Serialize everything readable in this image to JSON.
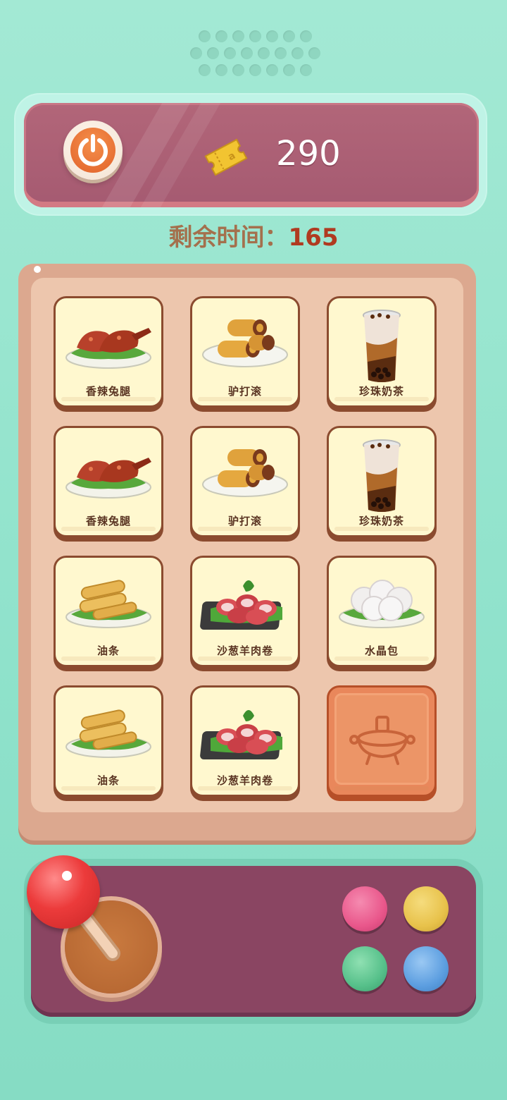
{
  "score": "290",
  "time": {
    "label": "剩余时间：",
    "value": "165"
  },
  "tiles": [
    {
      "label": "香辣兔腿",
      "food": "rabbit-leg"
    },
    {
      "label": "驴打滚",
      "food": "donkey-roll"
    },
    {
      "label": "珍珠奶茶",
      "food": "bubble-tea"
    },
    {
      "label": "香辣兔腿",
      "food": "rabbit-leg"
    },
    {
      "label": "驴打滚",
      "food": "donkey-roll"
    },
    {
      "label": "珍珠奶茶",
      "food": "bubble-tea"
    },
    {
      "label": "油条",
      "food": "youtiao"
    },
    {
      "label": "沙葱羊肉卷",
      "food": "lamb-roll"
    },
    {
      "label": "水晶包",
      "food": "crystal-bun"
    },
    {
      "label": "油条",
      "food": "youtiao"
    },
    {
      "label": "沙葱羊肉卷",
      "food": "lamb-roll"
    },
    {
      "label": "",
      "food": "face-down"
    }
  ],
  "icons": {
    "power": "power-icon",
    "ticket": "ticket-icon",
    "joystick": "joystick-icon",
    "hotpot": "hotpot-icon"
  },
  "colors": {
    "background": "#96e4ce",
    "topbar": "#a95d73",
    "time_value": "#b03a20",
    "board": "#dca88f",
    "tile": "#fff8cf",
    "tile_back": "#e9875b",
    "controller": "#8a4562",
    "button_pink": "#e9578b",
    "button_yellow": "#e8c24b",
    "button_green": "#56c08a",
    "button_blue": "#5c9ee0"
  }
}
